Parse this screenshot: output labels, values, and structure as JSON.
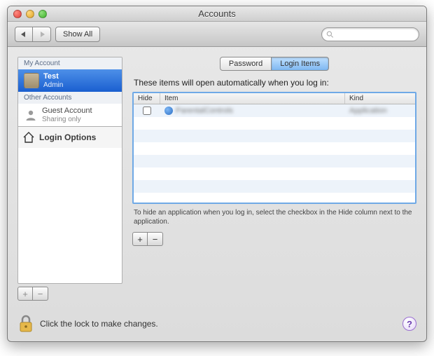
{
  "window": {
    "title": "Accounts"
  },
  "toolbar": {
    "show_all": "Show All",
    "search_placeholder": ""
  },
  "sidebar": {
    "my_account_header": "My Account",
    "other_accounts_header": "Other Accounts",
    "selected": {
      "name": "Test",
      "role": "Admin"
    },
    "guest": {
      "name": "Guest Account",
      "role": "Sharing only"
    },
    "login_options": "Login Options"
  },
  "tabs": {
    "password": "Password",
    "login_items": "Login Items"
  },
  "main": {
    "instruction": "These items will open automatically when you log in:",
    "columns": {
      "hide": "Hide",
      "item": "Item",
      "kind": "Kind"
    },
    "rows": [
      {
        "hide": false,
        "item": "ParentalControls",
        "kind": "Application"
      }
    ],
    "hint": "To hide an application when you log in, select the checkbox in the Hide column next to the application."
  },
  "footer": {
    "lock_text": "Click the lock to make changes."
  },
  "glyphs": {
    "plus": "+",
    "minus": "−",
    "help": "?"
  }
}
